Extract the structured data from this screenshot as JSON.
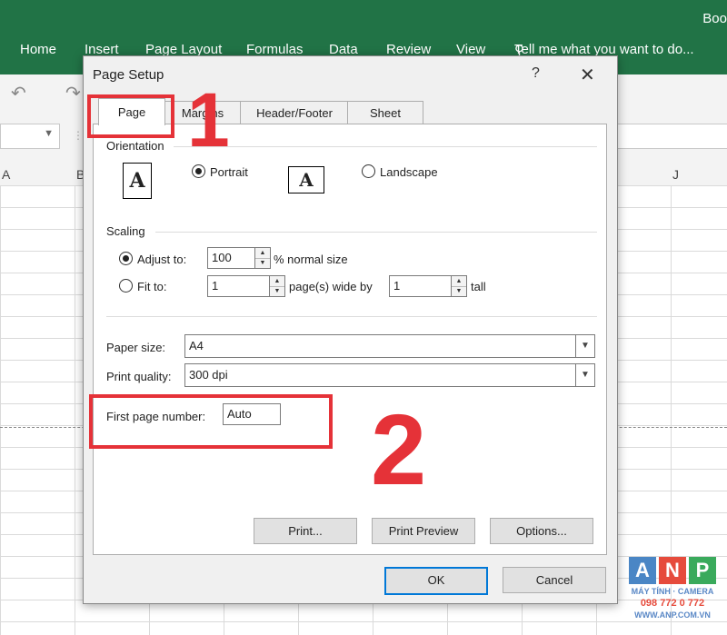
{
  "excel": {
    "title_partial": "Boo",
    "tabs": [
      "Home",
      "Insert",
      "Page Layout",
      "Formulas",
      "Data",
      "Review",
      "View",
      "Tell me what you want to do..."
    ],
    "columns": [
      "A",
      "B",
      "J"
    ]
  },
  "dialog": {
    "title": "Page Setup",
    "help": "?",
    "close": "✕",
    "tabs": [
      "Page",
      "Margins",
      "Header/Footer",
      "Sheet"
    ],
    "orientation": {
      "heading": "Orientation",
      "portrait_label": "Portrait",
      "landscape_label": "Landscape",
      "icon_letter": "A",
      "selected": "portrait"
    },
    "scaling": {
      "heading": "Scaling",
      "adjust_label": "Adjust to:",
      "adjust_value": "100",
      "adjust_suffix": "% normal size",
      "fit_label": "Fit to:",
      "fit_wide_value": "1",
      "fit_wide_suffix": "page(s) wide by",
      "fit_tall_value": "1",
      "fit_tall_suffix": "tall",
      "selected": "adjust"
    },
    "paper_size": {
      "label": "Paper size:",
      "value": "A4"
    },
    "print_quality": {
      "label": "Print quality:",
      "value": "300 dpi"
    },
    "first_page_number": {
      "label": "First page number:",
      "value": "Auto"
    },
    "buttons": {
      "print": "Print...",
      "print_preview": "Print Preview",
      "options": "Options...",
      "ok": "OK",
      "cancel": "Cancel"
    }
  },
  "annotations": {
    "step1": "1",
    "step2": "2"
  },
  "watermark": {
    "letters": [
      "A",
      "N",
      "P"
    ],
    "colors": [
      "#4a86c5",
      "#e64b3c",
      "#3aaa5c"
    ],
    "line1": "MÁY TÍNH · CAMERA",
    "line2": "098 772 0 772",
    "line3": "WWW.ANP.COM.VN"
  },
  "colors": {
    "excel_green": "#217346",
    "annotation_red": "#e53238",
    "focus_blue": "#0078d7"
  }
}
